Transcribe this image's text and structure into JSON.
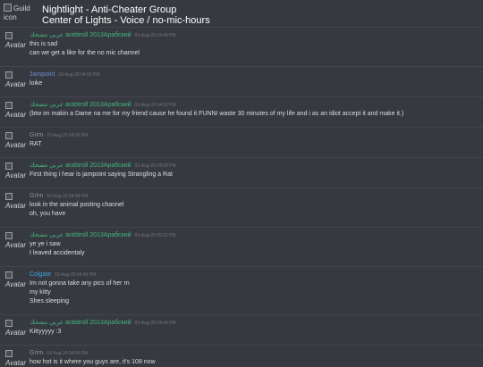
{
  "header": {
    "guild_icon_alt": "Guild icon",
    "title": "Nightlight - Anti-Cheater Group",
    "subtitle": "Center of Lights - Voice / no-mic-hours"
  },
  "avatar_alt": "Avatar",
  "colors": {
    "background": "#36393f",
    "arabtroll": "#43b581",
    "jampoint": "#7289da",
    "grim": "#8e9297",
    "colgate": "#3ba5dc",
    "text": "#dcddde",
    "timestamp": "#72767d"
  },
  "messages": [
    {
      "author": "عربي مضحك arabtroll 2013Арабский",
      "timestamp": "03-Aug-20 04:49 PM",
      "color": "#43b581",
      "lines": [
        "this is sad",
        "can we get a like for the no mic channel"
      ]
    },
    {
      "author": "Jampoint",
      "timestamp": "03-Aug-20 04:50 PM",
      "color": "#7289da",
      "lines": [
        "loike"
      ]
    },
    {
      "author": "عربي مضحك arabtroll 2013Арабский",
      "timestamp": "03-Aug-20 04:52 PM",
      "color": "#43b581",
      "lines": [
        "(btw im makin a Dame na me for my friend cause he found it FUNNI waste 30 minutes of my life and i as an idiot accept it and make it.)"
      ]
    },
    {
      "author": "Grim",
      "timestamp": "03-Aug-20 04:56 PM",
      "color": "#8e9297",
      "lines": [
        "RAT"
      ]
    },
    {
      "author": "عربي مضحك arabtroll 2013Арабский",
      "timestamp": "03-Aug-20 04:58 PM",
      "color": "#43b581",
      "lines": [
        "First thing i hear is jampoint saying Strangling a Rat"
      ]
    },
    {
      "author": "Grim",
      "timestamp": "03-Aug-20 04:58 PM",
      "color": "#8e9297",
      "lines": [
        "look in the animal posting channel",
        "oh, you have"
      ]
    },
    {
      "author": "عربي مضحك arabtroll 2013Арабский",
      "timestamp": "03-Aug-20 05:02 PM",
      "color": "#43b581",
      "lines": [
        "ye ye i saw",
        "I leaved accidentaly"
      ]
    },
    {
      "author": "Colgate",
      "timestamp": "03-Aug-20 04:49 PM",
      "color": "#3ba5dc",
      "lines": [
        "Im not gonna take any pics of her rn",
        "my kitty",
        "Shes sleeping"
      ]
    },
    {
      "author": "عربي مضحك arabtroll 2013Арабский",
      "timestamp": "03-Aug-20 04:49 PM",
      "color": "#43b581",
      "lines": [
        "Kittyyyyy :3"
      ]
    },
    {
      "author": "Grim",
      "timestamp": "03-Aug-20 04:59 PM",
      "color": "#8e9297",
      "lines": [
        "how hot is it where you guys are, it's 108 now"
      ]
    }
  ]
}
